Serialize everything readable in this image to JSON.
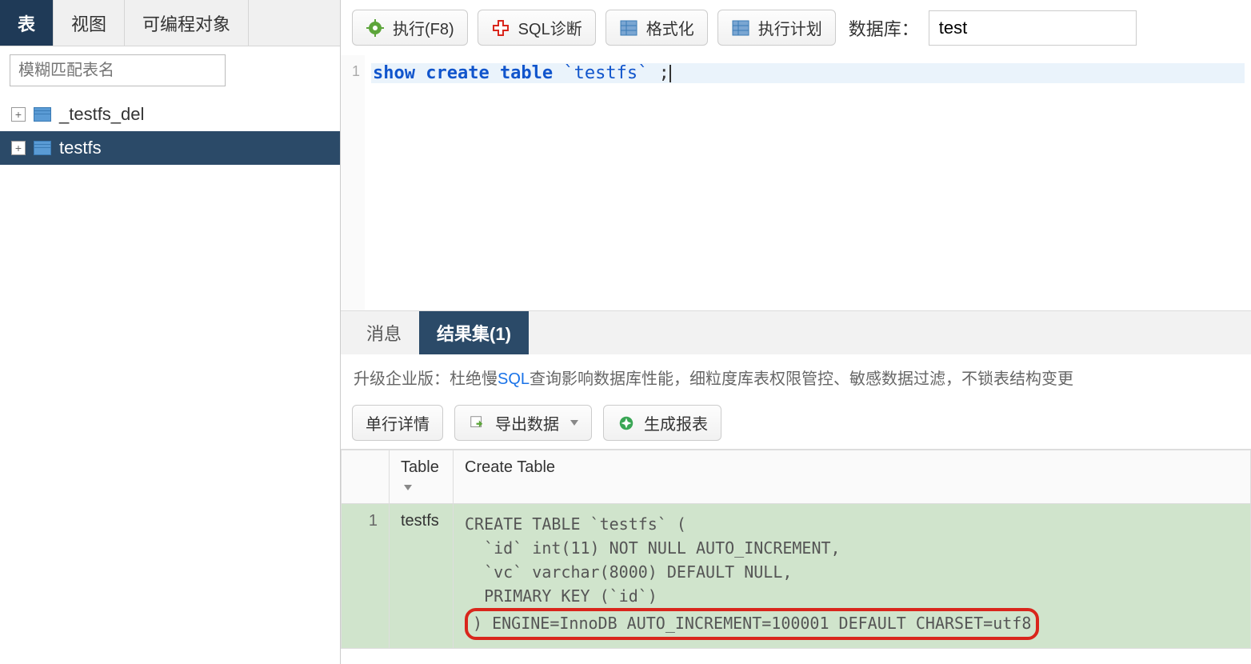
{
  "leftTabs": {
    "table": "表",
    "view": "视图",
    "programmable": "可编程对象"
  },
  "searchPlaceholder": "模糊匹配表名",
  "tree": [
    {
      "name": "_testfs_del",
      "selected": false
    },
    {
      "name": "testfs",
      "selected": true
    }
  ],
  "toolbar": {
    "execute": "执行(F8)",
    "diagnose": "SQL诊断",
    "format": "格式化",
    "plan": "执行计划",
    "dbLabel": "数据库：",
    "dbValue": "test"
  },
  "editor": {
    "lineNum": "1",
    "kw1": "show create table",
    "kw2": "`testfs`",
    "trail": " ;"
  },
  "resultTabs": {
    "message": "消息",
    "resultset": "结果集(1)"
  },
  "promo": {
    "t1": "升级企业版：杜绝慢",
    "t2": "SQL",
    "t3": "查询影响数据库性能，细粒度库表权限管控、敏感数据过滤，不锁表结构变更"
  },
  "resultToolbar": {
    "detail": "单行详情",
    "export": "导出数据",
    "report": "生成报表"
  },
  "headers": {
    "col1": "",
    "col2": "Table",
    "col3": "Create Table"
  },
  "row": {
    "num": "1",
    "tableLabel": "testfs",
    "l1": "CREATE TABLE `testfs` (",
    "l2": "  `id` int(11) NOT NULL AUTO_INCREMENT,",
    "l3": "  `vc` varchar(8000) DEFAULT NULL,",
    "l4": "  PRIMARY KEY (`id`)",
    "l5": ") ENGINE=InnoDB AUTO_INCREMENT=100001 DEFAULT CHARSET=utf8"
  }
}
